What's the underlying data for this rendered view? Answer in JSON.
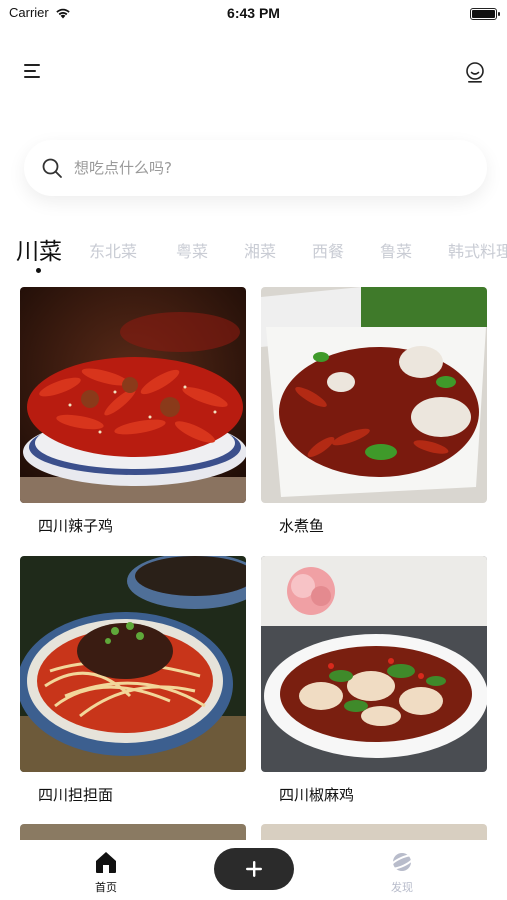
{
  "status_bar": {
    "carrier": "Carrier",
    "time": "6:43 PM"
  },
  "search": {
    "placeholder": "想吃点什么吗?"
  },
  "categories": [
    "川菜",
    "东北菜",
    "粤菜",
    "湘菜",
    "西餐",
    "鲁菜",
    "韩式料理"
  ],
  "active_category": "川菜",
  "dishes": [
    {
      "name": "四川辣子鸡"
    },
    {
      "name": "水煮鱼"
    },
    {
      "name": "四川担担面"
    },
    {
      "name": "四川椒麻鸡"
    }
  ],
  "tabbar": {
    "home_label": "首页",
    "discover_label": "发现"
  },
  "colors": {
    "active_text": "#111111",
    "inactive_category": "#c9ccd4",
    "add_button": "#2b2b2b",
    "inactive_tab": "#b8bccb"
  }
}
